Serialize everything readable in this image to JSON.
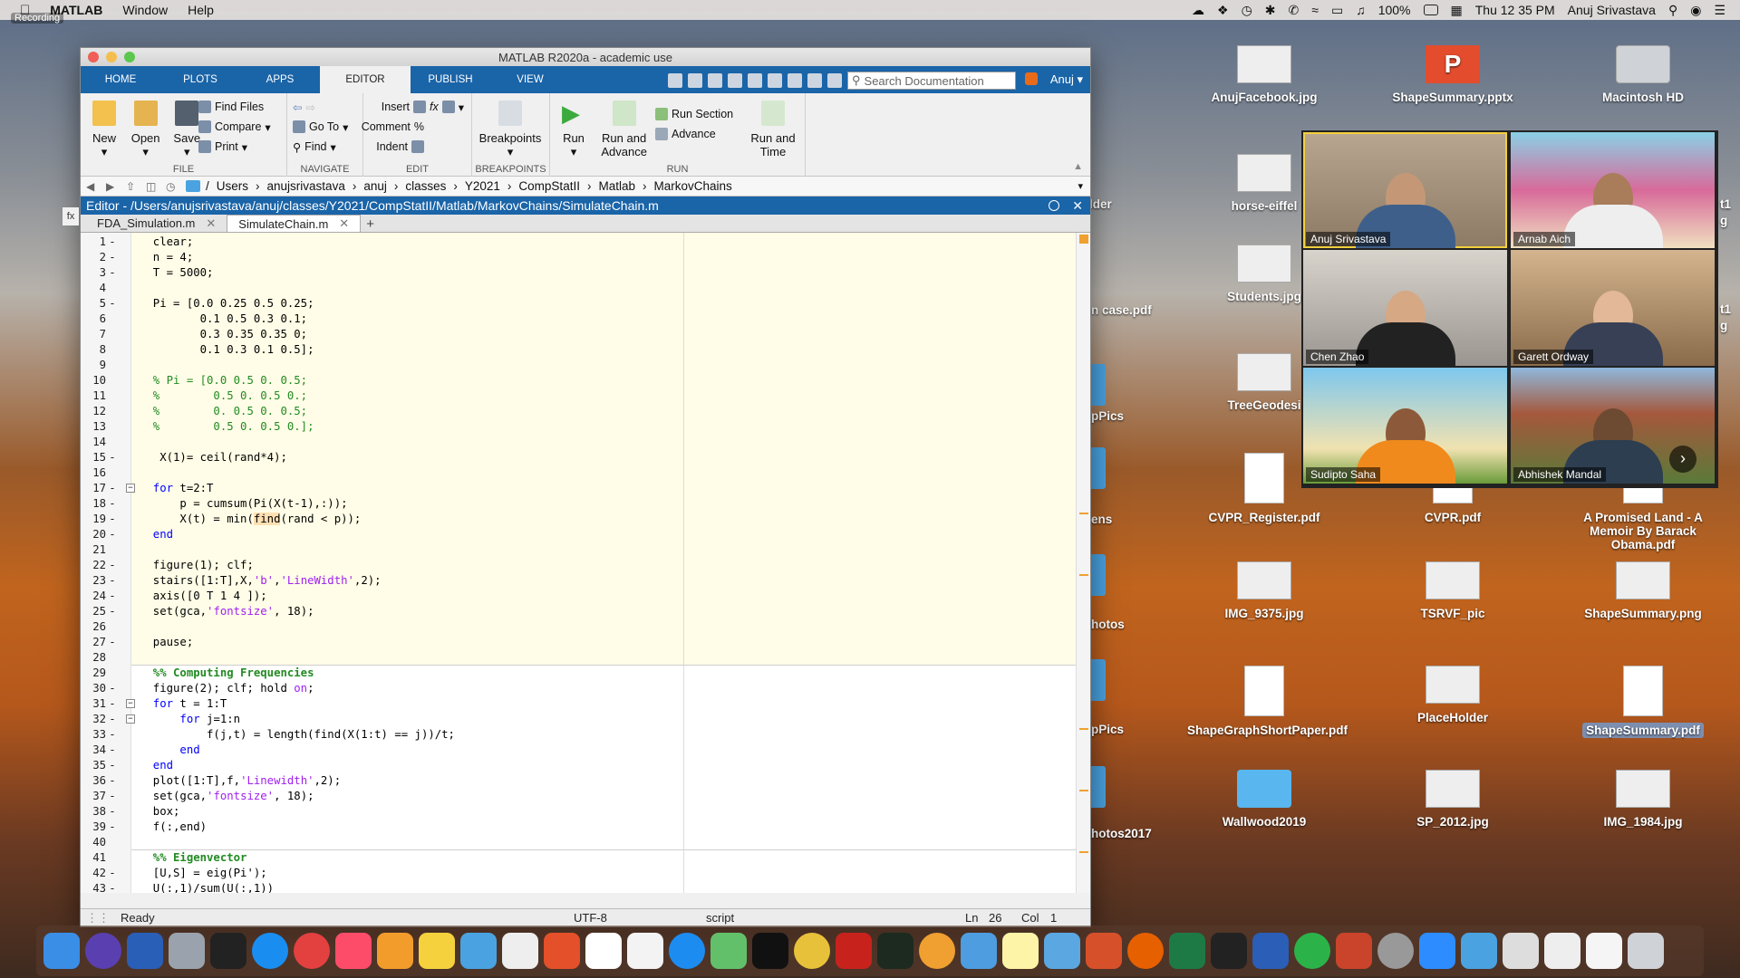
{
  "menubar": {
    "app": "MATLAB",
    "items": [
      "Window",
      "Help"
    ],
    "battery": "100%",
    "datetime": "Thu 12 35 PM",
    "user": "Anuj  Srivastava",
    "recording": "Recording"
  },
  "desktop": [
    {
      "label": "AnujFacebook.jpg",
      "kind": "img"
    },
    {
      "label": "ShapeSummary.pptx",
      "kind": "pp"
    },
    {
      "label": "Macintosh HD",
      "kind": "hd"
    },
    {
      "label": "horse-eiffel",
      "kind": "img"
    },
    {
      "label": "Students.jpg",
      "kind": "img"
    },
    {
      "label": "TreeGeodesi",
      "kind": "img"
    },
    {
      "label": "CVPR_Register.pdf",
      "kind": "doc"
    },
    {
      "label": "CVPR.pdf",
      "kind": "doc"
    },
    {
      "label": "A Promised Land - A Memoir By Barack Obama.pdf",
      "kind": "doc"
    },
    {
      "label": "IMG_9375.jpg",
      "kind": "img"
    },
    {
      "label": "TSRVF_pic",
      "kind": "img"
    },
    {
      "label": "ShapeSummary.png",
      "kind": "img"
    },
    {
      "label": "ShapeGraphShortPaper.pdf",
      "kind": "doc"
    },
    {
      "label": "PlaceHolder",
      "kind": "img"
    },
    {
      "label": "ShapeSummary.pdf",
      "kind": "doc"
    },
    {
      "label": "Wallwood2019",
      "kind": "folder"
    },
    {
      "label": "SP_2012.jpg",
      "kind": "img"
    },
    {
      "label": "IMG_1984.jpg",
      "kind": "img"
    }
  ],
  "desktop_cut": [
    "lder",
    "n case.pdf",
    "pPics",
    "ens",
    "hotos",
    "pPics",
    "hotos2017",
    "t1",
    "g",
    "t1",
    "g"
  ],
  "zoom": {
    "participants": [
      "Anuj Srivastava",
      "Arnab Aich",
      "Chen Zhao",
      "Garett Ordway",
      "Sudipto Saha",
      "Abhishek Mandal"
    ],
    "next": "›"
  },
  "matlab": {
    "title": "MATLAB R2020a - academic use",
    "tabs": [
      "HOME",
      "PLOTS",
      "APPS",
      "EDITOR",
      "PUBLISH",
      "VIEW"
    ],
    "active_tab": "EDITOR",
    "search_placeholder": "Search Documentation",
    "user": "Anuj",
    "ribbon": {
      "file": {
        "label": "FILE",
        "new": "New",
        "open": "Open",
        "save": "Save",
        "find_files": "Find Files",
        "compare": "Compare",
        "print": "Print"
      },
      "navigate": {
        "label": "NAVIGATE",
        "goto": "Go To",
        "find": "Find"
      },
      "edit": {
        "label": "EDIT",
        "insert": "Insert",
        "comment": "Comment",
        "indent": "Indent",
        "fx": "fx"
      },
      "breakpoints": {
        "label": "BREAKPOINTS",
        "btn": "Breakpoints"
      },
      "run": {
        "label": "RUN",
        "run": "Run",
        "run_advance": "Run and Advance",
        "run_section": "Run Section",
        "advance": "Advance",
        "run_time": "Run and Time"
      }
    },
    "path": [
      "/",
      "Users",
      "anujsrivastava",
      "anuj",
      "classes",
      "Y2021",
      "CompStatII",
      "Matlab",
      "MarkovChains"
    ],
    "side_label": "fx",
    "editor_title": "Editor - /Users/anujsrivastava/anuj/classes/Y2021/CompStatII/Matlab/MarkovChains/SimulateChain.m",
    "file_tabs": [
      "FDA_Simulation.m",
      "SimulateChain.m"
    ],
    "active_file": "SimulateChain.m",
    "status": {
      "ready": "Ready",
      "encoding": "UTF-8",
      "type": "script",
      "ln_label": "Ln",
      "ln": "26",
      "col_label": "Col",
      "col": "1"
    }
  },
  "code": [
    {
      "n": 1,
      "dash": true,
      "t": [
        [
          "",
          "  clear;"
        ]
      ]
    },
    {
      "n": 2,
      "dash": true,
      "t": [
        [
          "",
          "  n = 4;"
        ]
      ]
    },
    {
      "n": 3,
      "dash": true,
      "t": [
        [
          "",
          "  T = 5000;"
        ]
      ]
    },
    {
      "n": 4,
      "dash": false,
      "t": [
        [
          "",
          ""
        ]
      ]
    },
    {
      "n": 5,
      "dash": true,
      "t": [
        [
          "",
          "  Pi = [0.0 0.25 0.5 0.25;"
        ]
      ]
    },
    {
      "n": 6,
      "dash": false,
      "t": [
        [
          "",
          "         0.1 0.5 0.3 0.1;"
        ]
      ]
    },
    {
      "n": 7,
      "dash": false,
      "t": [
        [
          "",
          "         0.3 0.35 0.35 0;"
        ]
      ]
    },
    {
      "n": 8,
      "dash": false,
      "t": [
        [
          "",
          "         0.1 0.3 0.1 0.5];"
        ]
      ]
    },
    {
      "n": 9,
      "dash": false,
      "t": [
        [
          "",
          ""
        ]
      ]
    },
    {
      "n": 10,
      "dash": false,
      "t": [
        [
          "cm",
          "  % Pi = [0.0 0.5 0. 0.5;"
        ]
      ]
    },
    {
      "n": 11,
      "dash": false,
      "t": [
        [
          "cm",
          "  %        0.5 0. 0.5 0.;"
        ]
      ]
    },
    {
      "n": 12,
      "dash": false,
      "t": [
        [
          "cm",
          "  %        0. 0.5 0. 0.5;"
        ]
      ]
    },
    {
      "n": 13,
      "dash": false,
      "t": [
        [
          "cm",
          "  %        0.5 0. 0.5 0.];"
        ]
      ]
    },
    {
      "n": 14,
      "dash": false,
      "t": [
        [
          "",
          ""
        ]
      ]
    },
    {
      "n": 15,
      "dash": true,
      "t": [
        [
          "",
          "   X(1)= ceil(rand*4);"
        ]
      ]
    },
    {
      "n": 16,
      "dash": false,
      "t": [
        [
          "",
          ""
        ]
      ]
    },
    {
      "n": 17,
      "dash": true,
      "fold": "-",
      "t": [
        [
          "kw",
          "  for"
        ],
        [
          "",
          " t=2:T"
        ]
      ]
    },
    {
      "n": 18,
      "dash": true,
      "t": [
        [
          "",
          "      p = cumsum(Pi(X(t-1),:));"
        ]
      ]
    },
    {
      "n": 19,
      "dash": true,
      "t": [
        [
          "",
          "      X(t) = min("
        ],
        [
          "hl",
          "find"
        ],
        [
          "",
          "(rand < p));"
        ]
      ]
    },
    {
      "n": 20,
      "dash": true,
      "t": [
        [
          "kw",
          "  end"
        ]
      ]
    },
    {
      "n": 21,
      "dash": false,
      "t": [
        [
          "",
          ""
        ]
      ]
    },
    {
      "n": 22,
      "dash": true,
      "t": [
        [
          "",
          "  figure(1); clf;"
        ]
      ]
    },
    {
      "n": 23,
      "dash": true,
      "t": [
        [
          "",
          "  stairs([1:T],X,"
        ],
        [
          "str",
          "'b'"
        ],
        [
          "",
          ","
        ],
        [
          "str",
          "'LineWidth'"
        ],
        [
          "",
          ",2);"
        ]
      ]
    },
    {
      "n": 24,
      "dash": true,
      "t": [
        [
          "",
          "  axis([0 T 1 4 ]);"
        ]
      ]
    },
    {
      "n": 25,
      "dash": true,
      "t": [
        [
          "",
          "  set(gca,"
        ],
        [
          "str",
          "'fontsize'"
        ],
        [
          "",
          ", 18);"
        ]
      ]
    },
    {
      "n": 26,
      "dash": false,
      "t": [
        [
          "",
          ""
        ]
      ]
    },
    {
      "n": 27,
      "dash": true,
      "t": [
        [
          "",
          "  pause;"
        ]
      ]
    },
    {
      "n": 28,
      "dash": false,
      "t": [
        [
          "",
          ""
        ]
      ]
    },
    {
      "n": 29,
      "dash": false,
      "t": [
        [
          "cellt",
          "  %% Computing Frequencies"
        ]
      ]
    },
    {
      "n": 30,
      "dash": true,
      "t": [
        [
          "",
          "  figure(2); clf; hold "
        ],
        [
          "str",
          "on"
        ],
        [
          "",
          ";"
        ]
      ]
    },
    {
      "n": 31,
      "dash": true,
      "fold": "-",
      "t": [
        [
          "kw",
          "  for"
        ],
        [
          "",
          " t = 1:T"
        ]
      ]
    },
    {
      "n": 32,
      "dash": true,
      "fold": "-",
      "t": [
        [
          "kw",
          "      for"
        ],
        [
          "",
          " j=1:n"
        ]
      ]
    },
    {
      "n": 33,
      "dash": true,
      "t": [
        [
          "",
          "          f(j,t) = length(find(X(1:t) == j))/t;"
        ]
      ]
    },
    {
      "n": 34,
      "dash": true,
      "t": [
        [
          "kw",
          "      end"
        ]
      ]
    },
    {
      "n": 35,
      "dash": true,
      "t": [
        [
          "kw",
          "  end"
        ]
      ]
    },
    {
      "n": 36,
      "dash": true,
      "t": [
        [
          "",
          "  plot([1:T],f,"
        ],
        [
          "str",
          "'Linewidth'"
        ],
        [
          "",
          ",2);"
        ]
      ]
    },
    {
      "n": 37,
      "dash": true,
      "t": [
        [
          "",
          "  set(gca,"
        ],
        [
          "str",
          "'fontsize'"
        ],
        [
          "",
          ", 18);"
        ]
      ]
    },
    {
      "n": 38,
      "dash": true,
      "t": [
        [
          "",
          "  box;"
        ]
      ]
    },
    {
      "n": 39,
      "dash": true,
      "t": [
        [
          "",
          "  f(:,end)"
        ]
      ]
    },
    {
      "n": 40,
      "dash": false,
      "t": [
        [
          "",
          ""
        ]
      ]
    },
    {
      "n": 41,
      "dash": false,
      "t": [
        [
          "cellt",
          "  %% Eigenvector"
        ]
      ]
    },
    {
      "n": 42,
      "dash": true,
      "t": [
        [
          "",
          "  [U,S] = eig(Pi');"
        ]
      ]
    },
    {
      "n": 43,
      "dash": true,
      "t": [
        [
          "",
          "  U(:,1)/sum(U(:,1))"
        ]
      ]
    }
  ]
}
